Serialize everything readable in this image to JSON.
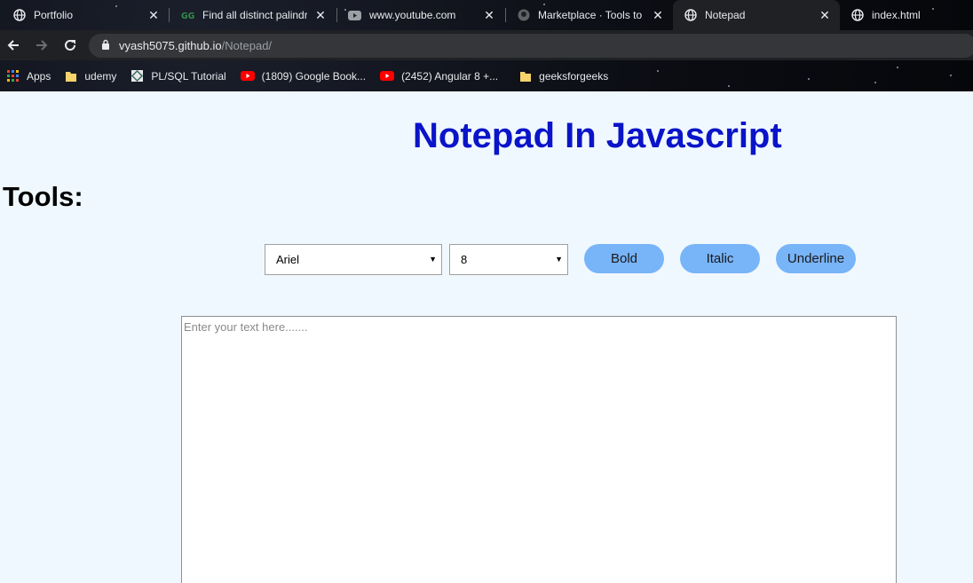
{
  "browser": {
    "tabs": [
      {
        "title": "Portfolio",
        "icon": "globe-icon"
      },
      {
        "title": "Find all distinct palindr",
        "icon": "gfg-icon"
      },
      {
        "title": "www.youtube.com",
        "icon": "youtube-icon"
      },
      {
        "title": "Marketplace · Tools to i",
        "icon": "github-icon"
      },
      {
        "title": "Notepad",
        "icon": "globe-icon"
      },
      {
        "title": "index.html",
        "icon": "globe-icon"
      }
    ],
    "active_tab": 4,
    "url_host": "vyash5075.github.io",
    "url_path": "/Notepad/",
    "bookmarks": [
      {
        "label": "Apps",
        "icon": "apps-grid-icon"
      },
      {
        "label": "udemy",
        "icon": "folder-icon"
      },
      {
        "label": "PL/SQL Tutorial",
        "icon": "plsql-icon"
      },
      {
        "label": "(1809) Google Book...",
        "icon": "youtube-icon"
      },
      {
        "label": "(2452) Angular 8 +...",
        "icon": "youtube-icon"
      },
      {
        "label": "geeksforgeeks",
        "icon": "folder-icon"
      }
    ]
  },
  "page": {
    "title": "Notepad In Javascript",
    "tools_label": "Tools:",
    "font_select_value": "Ariel",
    "size_select_value": "8",
    "bold_label": "Bold",
    "italic_label": "Italic",
    "underline_label": "Underline",
    "editor_placeholder": "Enter your text here......."
  },
  "colors": {
    "title": "#0a14c8",
    "page_bg": "#f0f8ff",
    "button_bg": "#78b4f8"
  }
}
